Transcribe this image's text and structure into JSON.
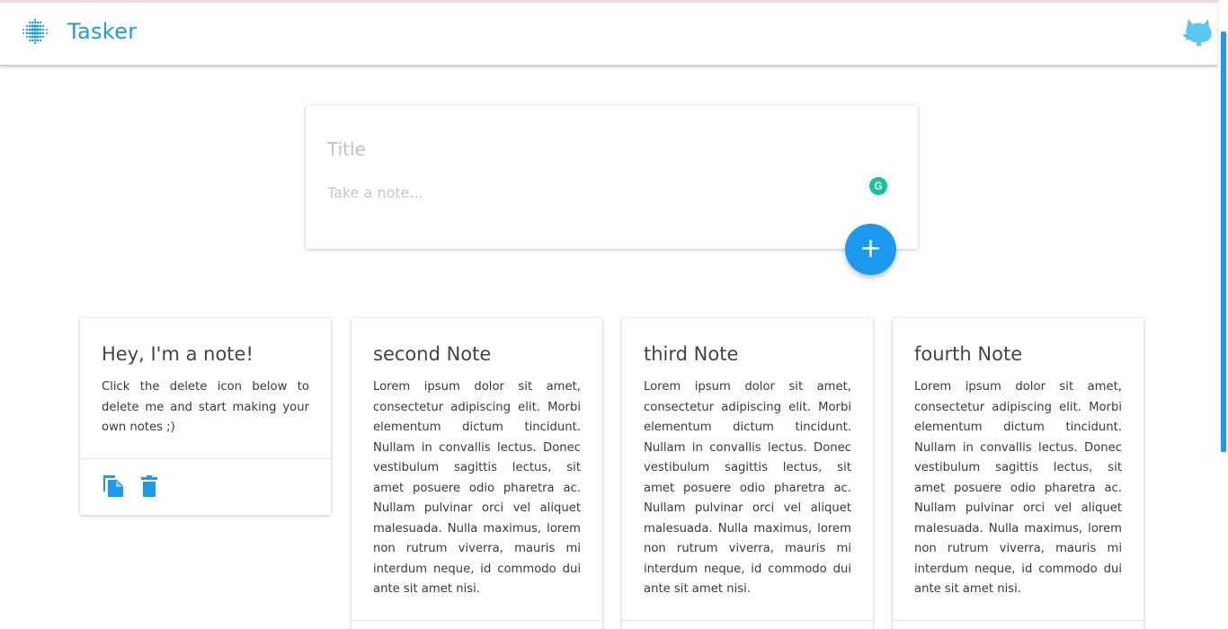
{
  "colors": {
    "accent": "#1e9be8",
    "fab": "#1a9bf0",
    "grammarly": "#15c39a"
  },
  "header": {
    "title": "Tasker",
    "logo_icon": "dot-grid-logo-icon",
    "github_icon": "octocat-icon"
  },
  "composer": {
    "title_placeholder": "Title",
    "note_placeholder": "Take a note...",
    "grammarly_label": "G",
    "add_label": "+"
  },
  "notes": [
    {
      "title": "Hey, I'm a note!",
      "body": "Click the delete icon below to delete me and start making your own notes ;)"
    },
    {
      "title": "second Note",
      "body": "Lorem ipsum dolor sit amet, consectetur adipiscing elit. Morbi elementum dictum tincidunt. Nullam in convallis lectus. Donec vestibulum sagittis lectus, sit amet posuere odio pharetra ac. Nullam pulvinar orci vel aliquet malesuada. Nulla maximus, lorem non rutrum viverra, mauris mi interdum neque, id commodo dui ante sit amet nisi."
    },
    {
      "title": "third Note",
      "body": "Lorem ipsum dolor sit amet, consectetur adipiscing elit. Morbi elementum dictum tincidunt. Nullam in convallis lectus. Donec vestibulum sagittis lectus, sit amet posuere odio pharetra ac. Nullam pulvinar orci vel aliquet malesuada. Nulla maximus, lorem non rutrum viverra, mauris mi interdum neque, id commodo dui ante sit amet nisi."
    },
    {
      "title": "fourth Note",
      "body": "Lorem ipsum dolor sit amet, consectetur adipiscing elit. Morbi elementum dictum tincidunt. Nullam in convallis lectus. Donec vestibulum sagittis lectus, sit amet posuere odio pharetra ac. Nullam pulvinar orci vel aliquet malesuada. Nulla maximus, lorem non rutrum viverra, mauris mi interdum neque, id commodo dui ante sit amet nisi."
    }
  ],
  "note_actions": {
    "copy_icon": "copy-icon",
    "delete_icon": "trash-icon"
  }
}
